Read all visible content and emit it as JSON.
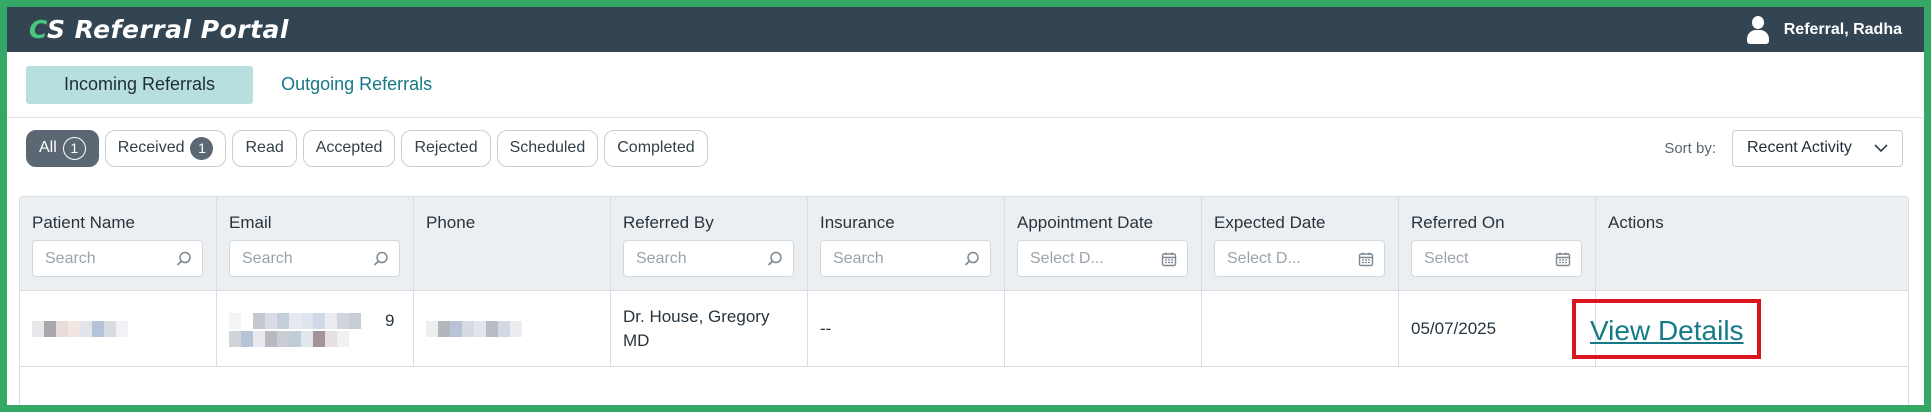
{
  "header": {
    "brand_accent": "C",
    "brand_rest": "S Referral Portal",
    "user_name": "Referral, Radha",
    "user_icon": "user-icon"
  },
  "tabs": [
    {
      "label": "Incoming Referrals",
      "active": true
    },
    {
      "label": "Outgoing Referrals",
      "active": false
    }
  ],
  "filters": {
    "chips": [
      {
        "label": "All",
        "count": "1"
      },
      {
        "label": "Received",
        "count": "1"
      },
      {
        "label": "Read"
      },
      {
        "label": "Accepted"
      },
      {
        "label": "Rejected"
      },
      {
        "label": "Scheduled"
      },
      {
        "label": "Completed"
      }
    ],
    "sort_label": "Sort by:",
    "sort_value": "Recent Activity"
  },
  "table": {
    "columns": [
      {
        "label": "Patient Name",
        "filter": "Search"
      },
      {
        "label": "Email",
        "filter": "Search"
      },
      {
        "label": "Phone"
      },
      {
        "label": "Referred By",
        "filter": "Search"
      },
      {
        "label": "Insurance",
        "filter": "Search"
      },
      {
        "label": "Appointment Date",
        "filter": "Select D..."
      },
      {
        "label": "Expected Date",
        "filter": "Select D..."
      },
      {
        "label": "Referred On",
        "filter": "Select"
      },
      {
        "label": "Actions"
      }
    ],
    "rows": [
      {
        "email_visible_char": "9",
        "referred_by": "Dr. House, Gregory MD",
        "insurance": "--",
        "appointment_date": "",
        "expected_date": "",
        "referred_on": "05/07/2025",
        "action": "View Details"
      }
    ]
  },
  "colors": {
    "topbar": "#334553",
    "accent_green": "#49c77c",
    "tab_active_bg": "#b7dfde",
    "link": "#157a86",
    "highlight_border": "#d8141d",
    "outer_border": "#36a866"
  }
}
